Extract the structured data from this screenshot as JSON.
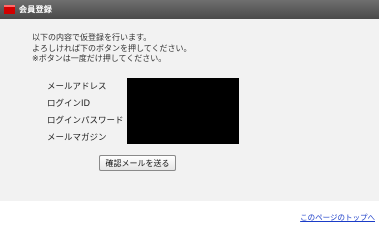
{
  "header": {
    "title": "会員登録",
    "icon": "red-square-icon",
    "accent_color": "#d10000"
  },
  "intro": {
    "lines": [
      "以下の内容で仮登録を行います。",
      "よろしければ下のボタンを押してください。",
      "※ボタンは一度だけ押してください。"
    ]
  },
  "form": {
    "labels": [
      "メールアドレス",
      "ログインID",
      "ログインパスワード",
      "メールマガジン"
    ]
  },
  "actions": {
    "send_label": "確認メールを送る"
  },
  "footer": {
    "top_link": "このページのトップへ"
  }
}
